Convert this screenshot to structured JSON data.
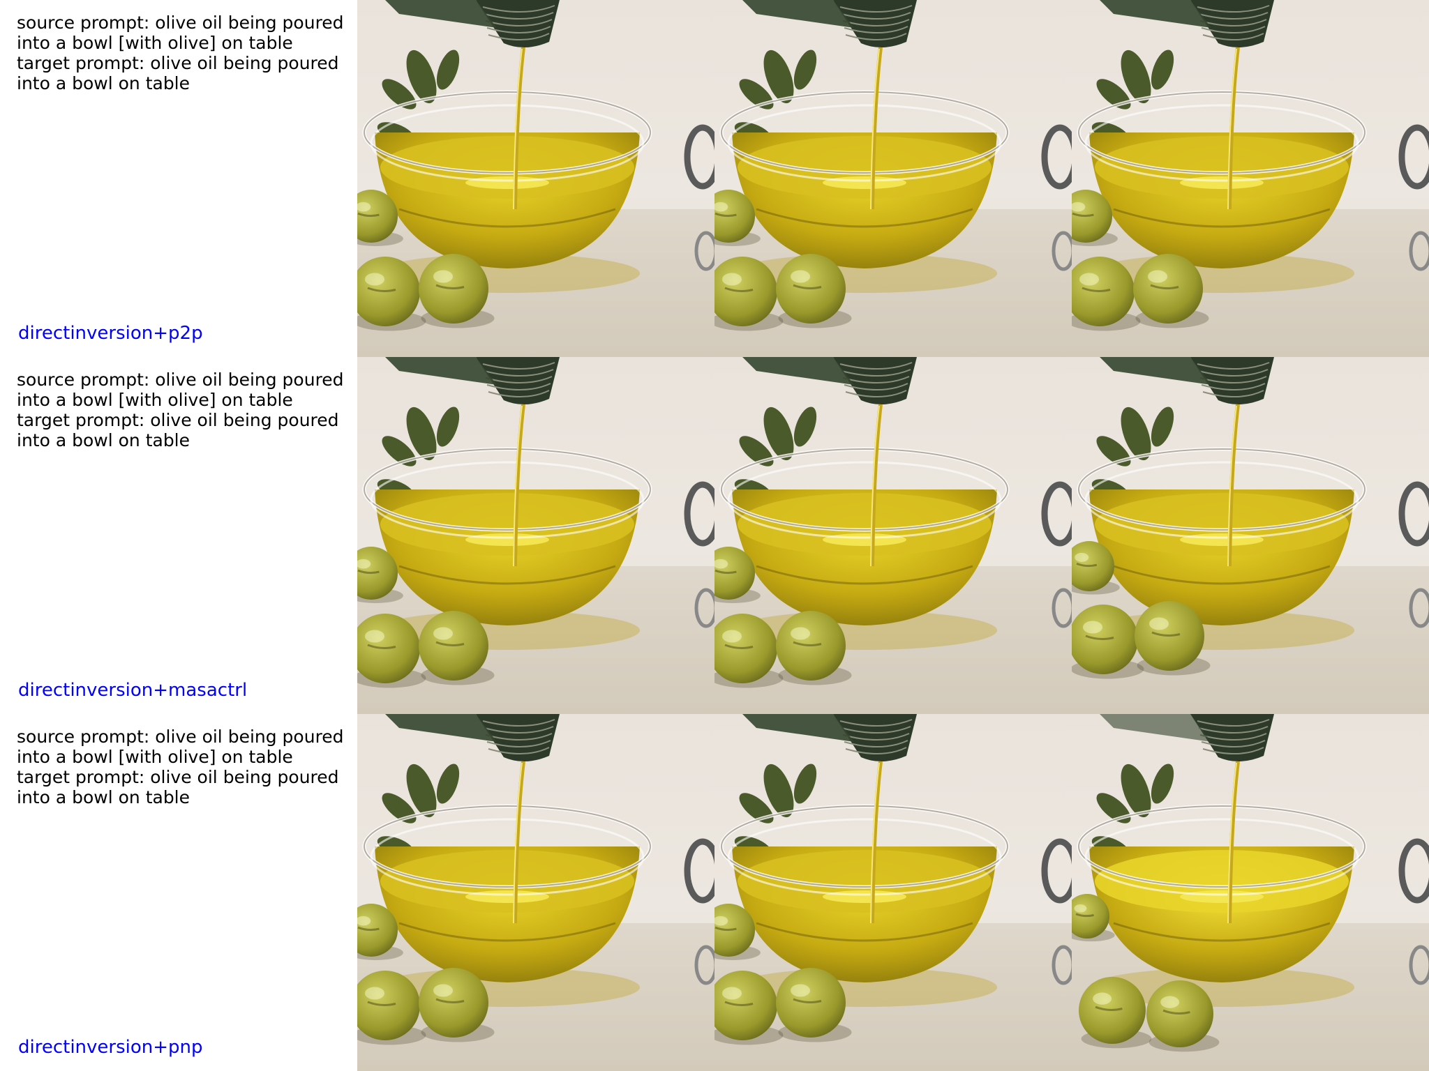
{
  "rows": [
    {
      "prompt_lines": [
        "source prompt: olive oil being poured",
        "into a bowl [with olive] on table",
        "target prompt: olive oil being poured",
        "into a bowl on table"
      ],
      "method": "directinversion+p2p"
    },
    {
      "prompt_lines": [
        "source prompt: olive oil being poured",
        "into a bowl [with olive] on table",
        "target prompt: olive oil being poured",
        "into a bowl on table"
      ],
      "method": "directinversion+masactrl"
    },
    {
      "prompt_lines": [
        "source prompt: olive oil being poured",
        "into a bowl [with olive] on table",
        "target prompt: olive oil being poured",
        "into a bowl on table"
      ],
      "method": "directinversion+pnp"
    }
  ],
  "colors": {
    "method_label": "#0000ff",
    "prompt_text": "#000000",
    "background": "#ffffff",
    "oil": "#c9b21a",
    "olive": "#a3a335",
    "table": "#e8e2d8"
  }
}
